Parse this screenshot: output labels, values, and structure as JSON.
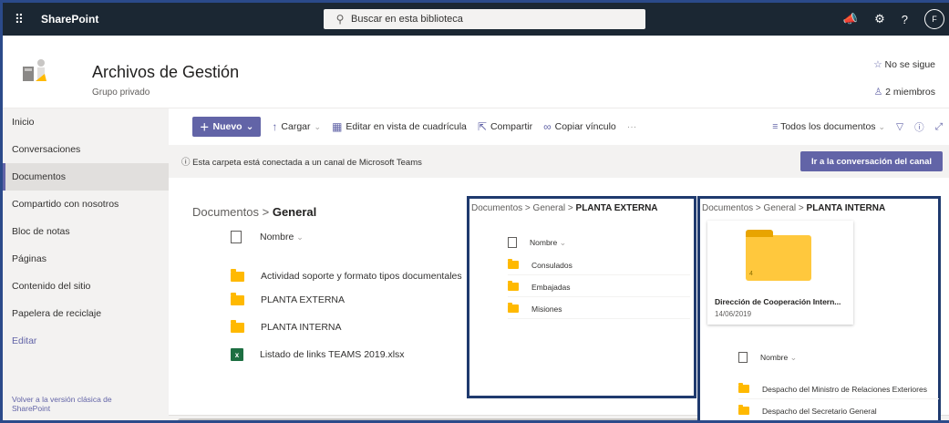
{
  "suitebar": {
    "app_name": "SharePoint",
    "search_placeholder": "Buscar en esta biblioteca",
    "avatar_initial": "F"
  },
  "site": {
    "title": "Archivos de Gestión",
    "subtitle": "Grupo privado",
    "follow_label": "No se sigue",
    "members_label": "2 miembros"
  },
  "nav": {
    "items": [
      {
        "label": "Inicio"
      },
      {
        "label": "Conversaciones"
      },
      {
        "label": "Documentos"
      },
      {
        "label": "Compartido con nosotros"
      },
      {
        "label": "Bloc de notas"
      },
      {
        "label": "Páginas"
      },
      {
        "label": "Contenido del sitio"
      },
      {
        "label": "Papelera de reciclaje"
      }
    ],
    "edit_label": "Editar",
    "classic_label": "Volver a la versión clásica de SharePoint"
  },
  "commands": {
    "new_label": "Nuevo",
    "upload_label": "Cargar",
    "grid_label": "Editar en vista de cuadrícula",
    "share_label": "Compartir",
    "copy_link_label": "Copiar vínculo",
    "more_label": "···",
    "view_label": "Todos los documentos"
  },
  "banner": {
    "text": "Esta carpeta está conectada a un canal de Microsoft Teams",
    "button_label": "Ir a la conversación del canal"
  },
  "main": {
    "breadcrumb_root": "Documentos",
    "breadcrumb_current": "General",
    "column_name": "Nombre",
    "files": [
      {
        "name": "Actividad soporte y formato tipos documentales",
        "type": "folder"
      },
      {
        "name": "PLANTA EXTERNA",
        "type": "folder"
      },
      {
        "name": "PLANTA INTERNA",
        "type": "folder"
      },
      {
        "name": "Listado de links TEAMS 2019.xlsx",
        "type": "xlsx"
      }
    ]
  },
  "panel_externa": {
    "bc_root": "Documentos",
    "bc_mid": "General",
    "bc_current": "PLANTA EXTERNA",
    "column_name": "Nombre",
    "folders": [
      "Consulados",
      "Embajadas",
      "Misiones"
    ]
  },
  "panel_interna": {
    "bc_root": "Documentos",
    "bc_mid": "General",
    "bc_current": "PLANTA INTERNA",
    "tile_name": "Dirección de Cooperación Intern...",
    "tile_date": "14/06/2019",
    "tile_count": "4",
    "column_name": "Nombre",
    "folders": [
      "Despacho del Ministro de Relaciones Exteriores",
      "Despacho del Secretario General"
    ]
  }
}
